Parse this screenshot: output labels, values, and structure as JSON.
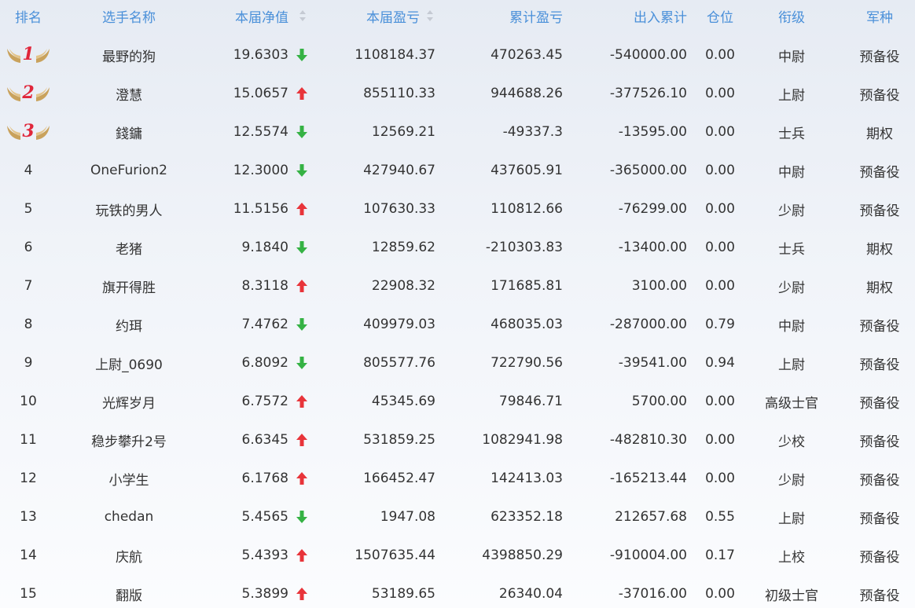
{
  "headers": {
    "rank": "排名",
    "name": "选手名称",
    "nav": "本届净值",
    "profit": "本届盈亏",
    "cumulative": "累计盈亏",
    "flow": "出入累计",
    "position": "仓位",
    "grade": "衔级",
    "arm": "军种"
  },
  "colors": {
    "header_text": "#4a90d9",
    "trend_up": "#e8343a",
    "trend_down": "#35b244",
    "medal_number": "#e0263a",
    "wing": "#c9a25c"
  },
  "rows": [
    {
      "rank": "1",
      "medal": true,
      "name": "最野的狗",
      "nav": "19.6303",
      "trend": "down",
      "profit": "1108184.37",
      "cumulative": "470263.45",
      "flow": "-540000.00",
      "position": "0.00",
      "grade": "中尉",
      "arm": "预备役"
    },
    {
      "rank": "2",
      "medal": true,
      "name": "澄慧",
      "nav": "15.0657",
      "trend": "up",
      "profit": "855110.33",
      "cumulative": "944688.26",
      "flow": "-377526.10",
      "position": "0.00",
      "grade": "上尉",
      "arm": "预备役"
    },
    {
      "rank": "3",
      "medal": true,
      "name": "錢鏞",
      "nav": "12.5574",
      "trend": "down",
      "profit": "12569.21",
      "cumulative": "-49337.3",
      "flow": "-13595.00",
      "position": "0.00",
      "grade": "士兵",
      "arm": "期权"
    },
    {
      "rank": "4",
      "medal": false,
      "name": "OneFurion2",
      "nav": "12.3000",
      "trend": "down",
      "profit": "427940.67",
      "cumulative": "437605.91",
      "flow": "-365000.00",
      "position": "0.00",
      "grade": "中尉",
      "arm": "预备役"
    },
    {
      "rank": "5",
      "medal": false,
      "name": "玩铁的男人",
      "nav": "11.5156",
      "trend": "up",
      "profit": "107630.33",
      "cumulative": "110812.66",
      "flow": "-76299.00",
      "position": "0.00",
      "grade": "少尉",
      "arm": "预备役"
    },
    {
      "rank": "6",
      "medal": false,
      "name": "老猪",
      "nav": "9.1840",
      "trend": "down",
      "profit": "12859.62",
      "cumulative": "-210303.83",
      "flow": "-13400.00",
      "position": "0.00",
      "grade": "士兵",
      "arm": "期权"
    },
    {
      "rank": "7",
      "medal": false,
      "name": "旗开得胜",
      "nav": "8.3118",
      "trend": "up",
      "profit": "22908.32",
      "cumulative": "171685.81",
      "flow": "3100.00",
      "position": "0.00",
      "grade": "少尉",
      "arm": "期权"
    },
    {
      "rank": "8",
      "medal": false,
      "name": "约珥",
      "nav": "7.4762",
      "trend": "down",
      "profit": "409979.03",
      "cumulative": "468035.03",
      "flow": "-287000.00",
      "position": "0.79",
      "grade": "中尉",
      "arm": "预备役"
    },
    {
      "rank": "9",
      "medal": false,
      "name": "上尉_0690",
      "nav": "6.8092",
      "trend": "down",
      "profit": "805577.76",
      "cumulative": "722790.56",
      "flow": "-39541.00",
      "position": "0.94",
      "grade": "上尉",
      "arm": "预备役"
    },
    {
      "rank": "10",
      "medal": false,
      "name": "光辉岁月",
      "nav": "6.7572",
      "trend": "up",
      "profit": "45345.69",
      "cumulative": "79846.71",
      "flow": "5700.00",
      "position": "0.00",
      "grade": "高级士官",
      "arm": "预备役"
    },
    {
      "rank": "11",
      "medal": false,
      "name": "稳步攀升2号",
      "nav": "6.6345",
      "trend": "up",
      "profit": "531859.25",
      "cumulative": "1082941.98",
      "flow": "-482810.30",
      "position": "0.00",
      "grade": "少校",
      "arm": "预备役"
    },
    {
      "rank": "12",
      "medal": false,
      "name": "小学生",
      "nav": "6.1768",
      "trend": "up",
      "profit": "166452.47",
      "cumulative": "142413.03",
      "flow": "-165213.44",
      "position": "0.00",
      "grade": "少尉",
      "arm": "预备役"
    },
    {
      "rank": "13",
      "medal": false,
      "name": "chedan",
      "nav": "5.4565",
      "trend": "down",
      "profit": "1947.08",
      "cumulative": "623352.18",
      "flow": "212657.68",
      "position": "0.55",
      "grade": "上尉",
      "arm": "预备役"
    },
    {
      "rank": "14",
      "medal": false,
      "name": "庆航",
      "nav": "5.4393",
      "trend": "up",
      "profit": "1507635.44",
      "cumulative": "4398850.29",
      "flow": "-910004.00",
      "position": "0.17",
      "grade": "上校",
      "arm": "预备役"
    },
    {
      "rank": "15",
      "medal": false,
      "name": "翻版",
      "nav": "5.3899",
      "trend": "up",
      "profit": "53189.65",
      "cumulative": "26340.04",
      "flow": "-37016.00",
      "position": "0.00",
      "grade": "初级士官",
      "arm": "预备役"
    }
  ]
}
